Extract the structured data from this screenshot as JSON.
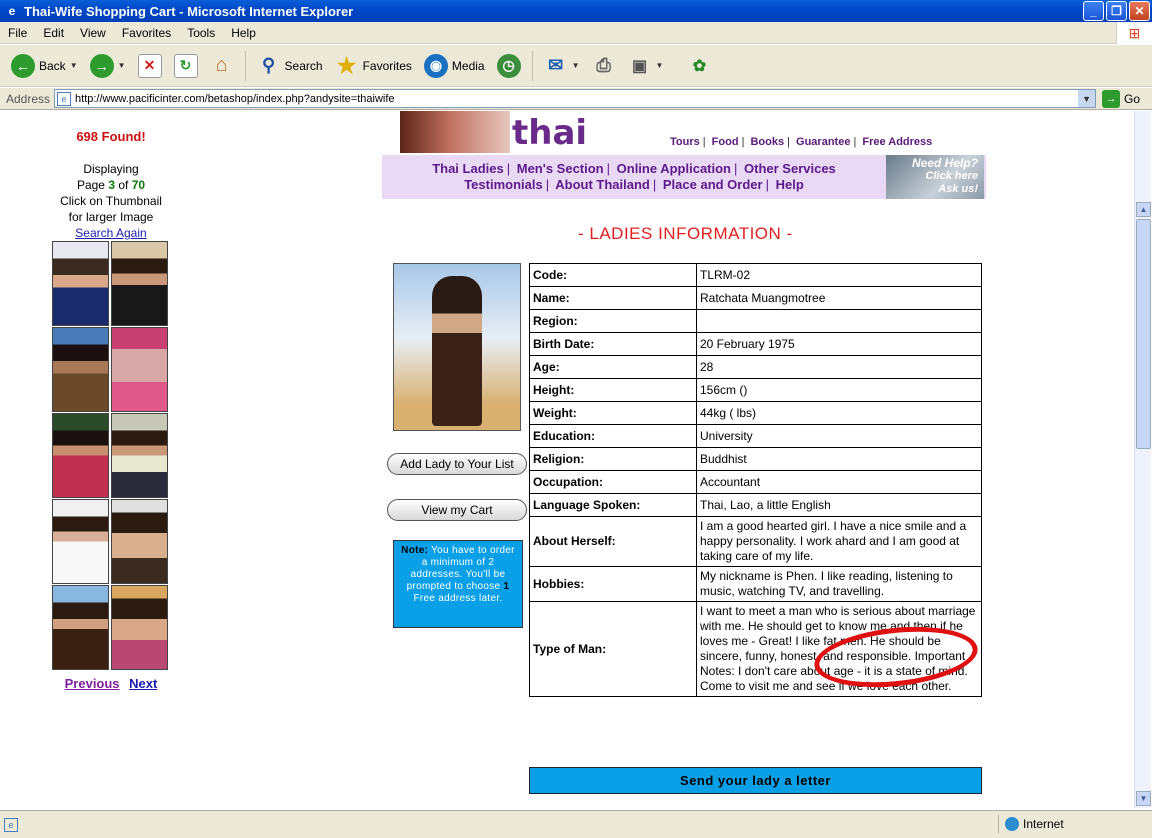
{
  "window": {
    "title": "Thai-Wife Shopping Cart - Microsoft Internet Explorer"
  },
  "menu": [
    "File",
    "Edit",
    "View",
    "Favorites",
    "Tools",
    "Help"
  ],
  "toolbar": {
    "back": "Back",
    "search": "Search",
    "favorites": "Favorites",
    "media": "Media"
  },
  "address": {
    "label": "Address",
    "url": "http://www.pacificinter.com/betashop/index.php?andysite=thaiwife",
    "go": "Go"
  },
  "status": {
    "zone": "Internet"
  },
  "left": {
    "found": "698 Found!",
    "displaying": "Displaying",
    "page_prefix": "Page",
    "page_current": "3",
    "page_of": "of",
    "page_total": "70",
    "click_line1": "Click on Thumbnail",
    "click_line2": "for larger Image",
    "search_again": "Search Again",
    "previous": "Previous",
    "next": "Next"
  },
  "header": {
    "logo": "thai wife",
    "toplinks": [
      "Tours",
      "Food",
      "Books",
      "Guarantee",
      "Free Address"
    ],
    "nav_row1": [
      "Thai Ladies",
      "Men's Section",
      "Online Application",
      "Other Services"
    ],
    "nav_row2": [
      "Testimonials",
      "About Thailand",
      "Place and Order",
      "Help"
    ],
    "help_line1": "Need Help?",
    "help_line2": "Click here",
    "help_line3": "Ask us!"
  },
  "ladies_title": "- LADIES INFORMATION -",
  "buttons": {
    "add": "Add Lady to Your List",
    "cart": "View my Cart"
  },
  "note": {
    "bold": "Note:",
    "text1": " You have to order a minimum of 2 addresses. You'll be prompted to choose ",
    "bold2": "1",
    "text2": " Free address later."
  },
  "info": [
    {
      "k": "Code:",
      "v": "TLRM-02"
    },
    {
      "k": "Name:",
      "v": "Ratchata Muangmotree"
    },
    {
      "k": "Region:",
      "v": ""
    },
    {
      "k": "Birth Date:",
      "v": "20 February 1975"
    },
    {
      "k": "Age:",
      "v": "28"
    },
    {
      "k": "Height:",
      "v": "156cm ()"
    },
    {
      "k": "Weight:",
      "v": "44kg ( lbs)"
    },
    {
      "k": "Education:",
      "v": "University"
    },
    {
      "k": "Religion:",
      "v": "Buddhist"
    },
    {
      "k": "Occupation:",
      "v": "Accountant"
    },
    {
      "k": "Language Spoken:",
      "v": "Thai, Lao, a little English"
    },
    {
      "k": "About Herself:",
      "v": "I am a good hearted girl. I have a nice smile and a happy personality. I work ahard and I am good at taking care of my life."
    },
    {
      "k": "Hobbies:",
      "v": "My nickname is Phen. I like reading, listening to music, watching TV, and travelling."
    },
    {
      "k": "Type of Man:",
      "v": "I want to meet a man who is serious about marriage with me. He should get to know me and then if he loves me - Great! I like fat men. He should be sincere, funny, honest, and responsible. Important Notes: I don't care about age - it is a state of mind. Come to visit me and see if we love each other."
    }
  ],
  "letter": "Send your lady a letter"
}
